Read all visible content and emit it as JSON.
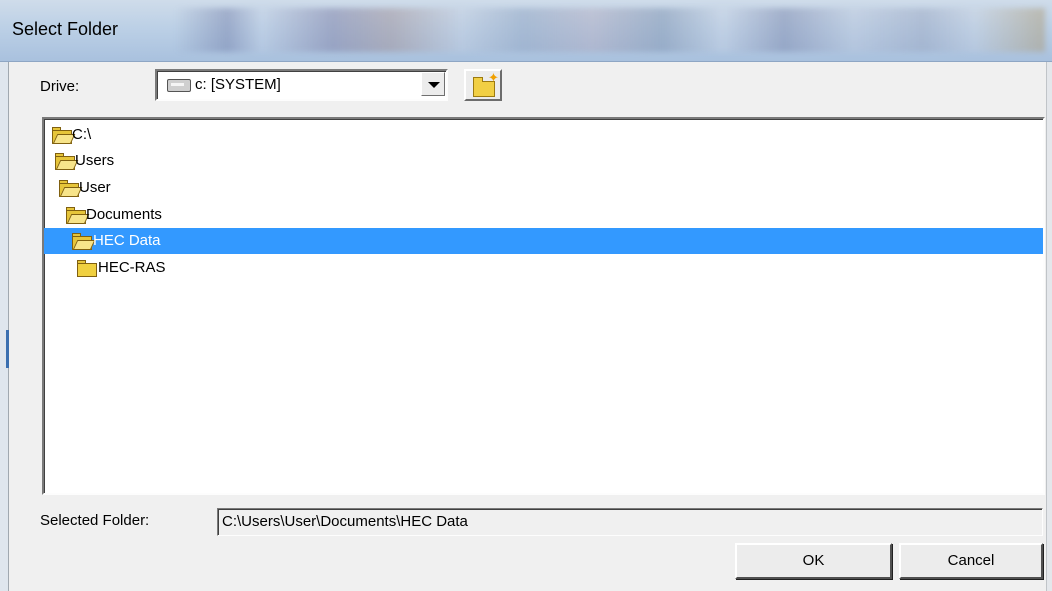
{
  "window": {
    "title": "Select Folder"
  },
  "drive": {
    "label": "Drive:",
    "value": "c: [SYSTEM]"
  },
  "tree": {
    "items": [
      {
        "label": "C:\\",
        "state": "open",
        "selected": false
      },
      {
        "label": "Users",
        "state": "open",
        "selected": false
      },
      {
        "label": "User",
        "state": "open",
        "selected": false
      },
      {
        "label": "Documents",
        "state": "open",
        "selected": false
      },
      {
        "label": "HEC Data",
        "state": "open",
        "selected": true
      },
      {
        "label": "HEC-RAS",
        "state": "closed",
        "selected": false
      }
    ]
  },
  "selected_folder": {
    "label": "Selected Folder:",
    "value": "C:\\Users\\User\\Documents\\HEC Data"
  },
  "buttons": {
    "ok": "OK",
    "cancel": "Cancel"
  },
  "colors": {
    "selection": "#3399ff",
    "folder": "#e6c53a"
  },
  "icons": {
    "drive": "hard-drive-icon",
    "new_folder": "new-folder-icon",
    "folder_open": "open-folder-icon",
    "folder_closed": "folder-icon"
  }
}
